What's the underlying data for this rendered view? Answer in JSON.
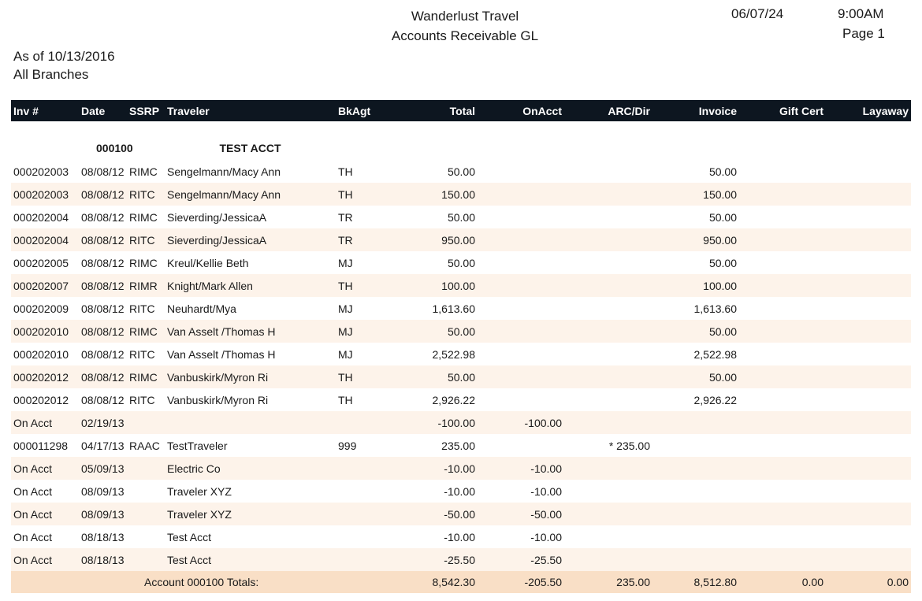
{
  "report": {
    "company": "Wanderlust Travel",
    "title": "Accounts Receivable GL",
    "print_date": "06/07/24",
    "print_time": "9:00AM",
    "page": "Page 1",
    "as_of": "As of 10/13/2016",
    "branches": "All Branches"
  },
  "columns": [
    "Inv #",
    "Date",
    "SSRP",
    "Traveler",
    "BkAgt",
    "Total",
    "OnAcct",
    "ARC/Dir",
    "Invoice",
    "Gift Cert",
    "Layaway"
  ],
  "group": {
    "account": "000100",
    "name": "TEST ACCT"
  },
  "rows": [
    [
      "000202003",
      "08/08/12",
      "RIMC",
      "Sengelmann/Macy Ann",
      "TH",
      "50.00",
      "",
      "",
      "50.00",
      "",
      ""
    ],
    [
      "000202003",
      "08/08/12",
      "RITC",
      "Sengelmann/Macy Ann",
      "TH",
      "150.00",
      "",
      "",
      "150.00",
      "",
      ""
    ],
    [
      "000202004",
      "08/08/12",
      "RIMC",
      "Sieverding/JessicaA",
      "TR",
      "50.00",
      "",
      "",
      "50.00",
      "",
      ""
    ],
    [
      "000202004",
      "08/08/12",
      "RITC",
      "Sieverding/JessicaA",
      "TR",
      "950.00",
      "",
      "",
      "950.00",
      "",
      ""
    ],
    [
      "000202005",
      "08/08/12",
      "RIMC",
      "Kreul/Kellie Beth",
      "MJ",
      "50.00",
      "",
      "",
      "50.00",
      "",
      ""
    ],
    [
      "000202007",
      "08/08/12",
      "RIMR",
      "Knight/Mark Allen",
      "TH",
      "100.00",
      "",
      "",
      "100.00",
      "",
      ""
    ],
    [
      "000202009",
      "08/08/12",
      "RITC",
      "Neuhardt/Mya",
      "MJ",
      "1,613.60",
      "",
      "",
      "1,613.60",
      "",
      ""
    ],
    [
      "000202010",
      "08/08/12",
      "RIMC",
      "Van Asselt /Thomas H",
      "MJ",
      "50.00",
      "",
      "",
      "50.00",
      "",
      ""
    ],
    [
      "000202010",
      "08/08/12",
      "RITC",
      "Van Asselt /Thomas H",
      "MJ",
      "2,522.98",
      "",
      "",
      "2,522.98",
      "",
      ""
    ],
    [
      "000202012",
      "08/08/12",
      "RIMC",
      "Vanbuskirk/Myron Ri",
      "TH",
      "50.00",
      "",
      "",
      "50.00",
      "",
      ""
    ],
    [
      "000202012",
      "08/08/12",
      "RITC",
      "Vanbuskirk/Myron Ri",
      "TH",
      "2,926.22",
      "",
      "",
      "2,926.22",
      "",
      ""
    ],
    [
      "On Acct",
      "02/19/13",
      "",
      "",
      "",
      "-100.00",
      "-100.00",
      "",
      "",
      "",
      ""
    ],
    [
      "000011298",
      "04/17/13",
      "RAAC",
      "TestTraveler",
      "999",
      "235.00",
      "",
      "* 235.00",
      "",
      "",
      ""
    ],
    [
      "On Acct",
      "05/09/13",
      "",
      "Electric Co",
      "",
      "-10.00",
      "-10.00",
      "",
      "",
      "",
      ""
    ],
    [
      "On Acct",
      "08/09/13",
      "",
      "Traveler XYZ",
      "",
      "-10.00",
      "-10.00",
      "",
      "",
      "",
      ""
    ],
    [
      "On Acct",
      "08/09/13",
      "",
      "Traveler XYZ",
      "",
      "-50.00",
      "-50.00",
      "",
      "",
      "",
      ""
    ],
    [
      "On Acct",
      "08/18/13",
      "",
      "Test Acct",
      "",
      "-10.00",
      "-10.00",
      "",
      "",
      "",
      ""
    ],
    [
      "On Acct",
      "08/18/13",
      "",
      "Test Acct",
      "",
      "-25.50",
      "-25.50",
      "",
      "",
      "",
      ""
    ]
  ],
  "totals": {
    "label": "Account 000100 Totals:",
    "total": "8,542.30",
    "onacct": "-205.50",
    "arc_dir": "235.00",
    "invoice": "8,512.80",
    "gift_cert": "0.00",
    "layaway": "0.00"
  },
  "colors": {
    "header_bg": "#0d1620",
    "stripe": "#fdf3ea",
    "total_bg": "#f9dfc6"
  }
}
